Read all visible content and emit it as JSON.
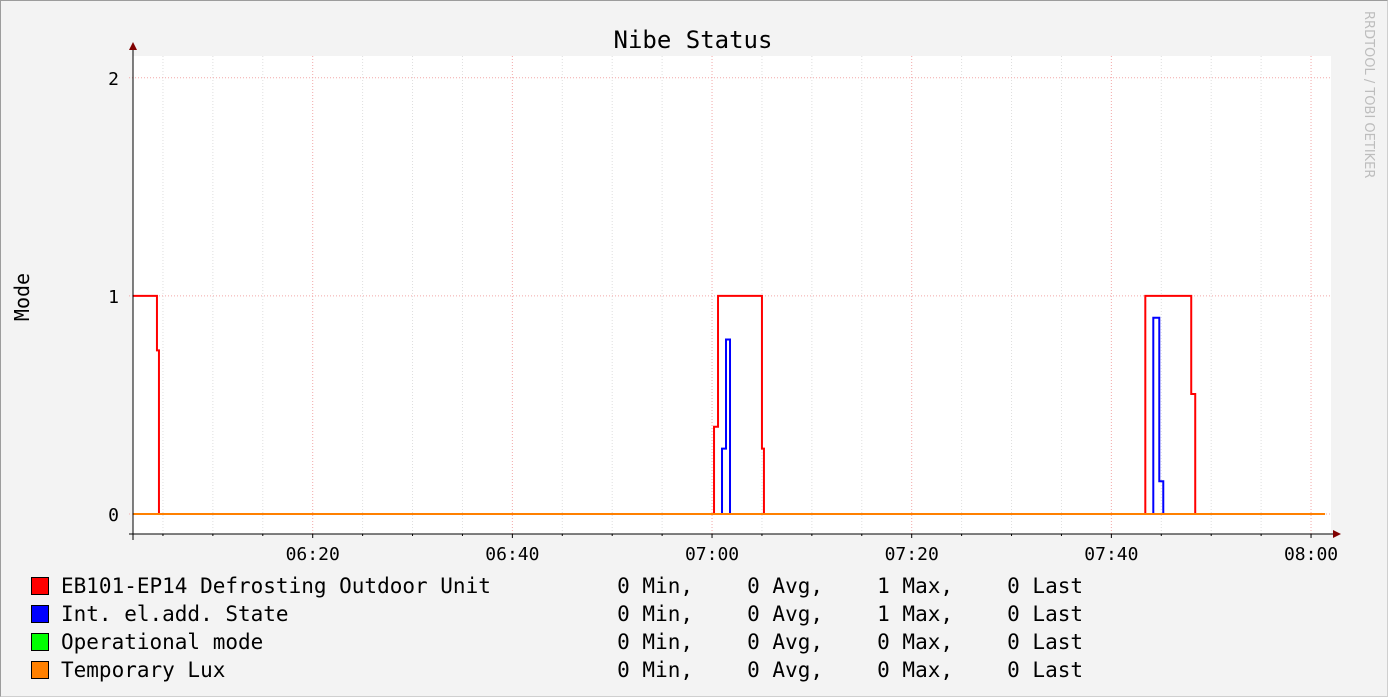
{
  "chart_data": {
    "type": "line",
    "title": "Nibe Status",
    "ylabel": "Mode",
    "watermark": "RRDTOOL / TOBI OETIKER",
    "x_range": [
      "06:02",
      "08:02"
    ],
    "ylim": [
      0,
      2.1
    ],
    "x_ticks": [
      "06:20",
      "06:40",
      "07:00",
      "07:20",
      "07:40",
      "08:00"
    ],
    "y_ticks": [
      "0",
      "1",
      "2"
    ],
    "grid": true,
    "series": [
      {
        "name": "EB101-EP14 Defrosting Outdoor Unit",
        "color": "#ff0000",
        "step": true,
        "points": [
          [
            "06:02",
            1
          ],
          [
            "06:04.4",
            0.75
          ],
          [
            "06:04.6",
            0
          ],
          [
            "07:00.2",
            0.4
          ],
          [
            "07:00.6",
            1
          ],
          [
            "07:05",
            0.3
          ],
          [
            "07:05.2",
            0
          ],
          [
            "07:43.4",
            1
          ],
          [
            "07:48",
            0.55
          ],
          [
            "07:48.4",
            0
          ]
        ]
      },
      {
        "name": "Int. el.add. State",
        "color": "#0000ff",
        "step": true,
        "points": [
          [
            "06:02",
            0
          ],
          [
            "07:01",
            0.3
          ],
          [
            "07:01.4",
            0.8
          ],
          [
            "07:01.8",
            0
          ],
          [
            "07:44.2",
            0.9
          ],
          [
            "07:44.8",
            0.15
          ],
          [
            "07:45.2",
            0
          ]
        ]
      },
      {
        "name": "Operational mode",
        "color": "#00ff00",
        "step": true,
        "points": [
          [
            "06:02",
            0
          ],
          [
            "08:01.4",
            0
          ]
        ]
      },
      {
        "name": "Temporary Lux",
        "color": "#ff8000",
        "step": true,
        "points": [
          [
            "06:02",
            0
          ],
          [
            "08:01.4",
            0
          ]
        ]
      }
    ],
    "legend": [
      {
        "name": "EB101-EP14 Defrosting Outdoor Unit",
        "color": "#ff0000",
        "min": "0 Min,",
        "avg": "0 Avg,",
        "max": "1 Max,",
        "last": "0 Last"
      },
      {
        "name": "Int. el.add. State",
        "color": "#0000ff",
        "min": "0 Min,",
        "avg": "0 Avg,",
        "max": "1 Max,",
        "last": "0 Last"
      },
      {
        "name": "Operational mode",
        "color": "#00ff00",
        "min": "0 Min,",
        "avg": "0 Avg,",
        "max": "0 Max,",
        "last": "0 Last"
      },
      {
        "name": "Temporary Lux",
        "color": "#ff8000",
        "min": "0 Min,",
        "avg": "0 Avg,",
        "max": "0 Max,",
        "last": "0 Last"
      }
    ]
  }
}
